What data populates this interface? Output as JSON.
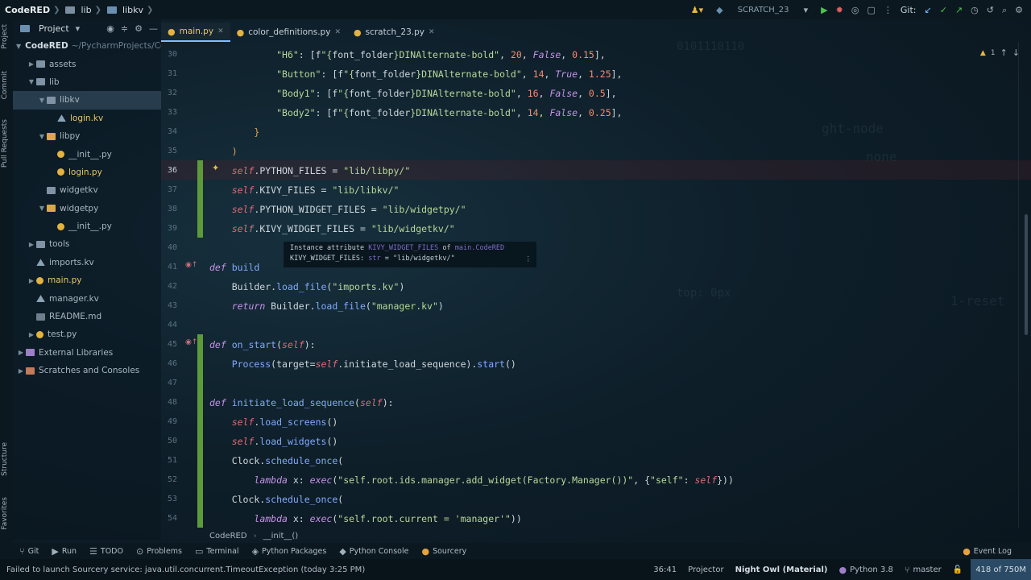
{
  "titlebar": {
    "crumbs": [
      "CodeRED",
      "lib",
      "libkv"
    ],
    "run_config": "SCRATCH_23",
    "git_label": "Git:"
  },
  "left_strip": {
    "top_labels": [
      "Project",
      "Commit",
      "Pull Requests"
    ],
    "bottom_labels": [
      "Structure",
      "Favorites"
    ]
  },
  "project": {
    "header": "Project",
    "tree": [
      {
        "name": "CodeRED",
        "path": "~/PycharmProjects/Co",
        "indent": 0,
        "type": "folder-b",
        "arrow": "▼"
      },
      {
        "name": "assets",
        "indent": 1,
        "type": "folder",
        "arrow": "▶"
      },
      {
        "name": "lib",
        "indent": 1,
        "type": "folder",
        "arrow": "▼"
      },
      {
        "name": "libkv",
        "indent": 2,
        "type": "folder",
        "arrow": "▼",
        "selected": true
      },
      {
        "name": "login.kv",
        "indent": 3,
        "type": "kv",
        "yellow": true
      },
      {
        "name": "libpy",
        "indent": 2,
        "type": "folder-y",
        "arrow": "▼"
      },
      {
        "name": "__init__.py",
        "indent": 3,
        "type": "py"
      },
      {
        "name": "login.py",
        "indent": 3,
        "type": "py",
        "yellow": true
      },
      {
        "name": "widgetkv",
        "indent": 2,
        "type": "folder"
      },
      {
        "name": "widgetpy",
        "indent": 2,
        "type": "folder-y",
        "arrow": "▼"
      },
      {
        "name": "__init__.py",
        "indent": 3,
        "type": "py"
      },
      {
        "name": "tools",
        "indent": 1,
        "type": "folder",
        "arrow": "▶"
      },
      {
        "name": "imports.kv",
        "indent": 1,
        "type": "kv"
      },
      {
        "name": "main.py",
        "indent": 1,
        "type": "py",
        "yellow": true,
        "arrow": "▶"
      },
      {
        "name": "manager.kv",
        "indent": 1,
        "type": "kv"
      },
      {
        "name": "README.md",
        "indent": 1,
        "type": "md"
      },
      {
        "name": "test.py",
        "indent": 1,
        "type": "py",
        "arrow": "▶"
      },
      {
        "name": "External Libraries",
        "indent": 0,
        "type": "lib",
        "arrow": "▶"
      },
      {
        "name": "Scratches and Consoles",
        "indent": 0,
        "type": "scr",
        "arrow": "▶"
      }
    ]
  },
  "tabs": [
    {
      "label": "main.py",
      "active": true
    },
    {
      "label": "color_definitions.py",
      "active": false
    },
    {
      "label": "scratch_23.py",
      "active": false
    }
  ],
  "inspection": {
    "warning_count": "1"
  },
  "gutter": {
    "lines": [
      "30",
      "31",
      "32",
      "33",
      "34",
      "35",
      "36",
      "37",
      "38",
      "39",
      "40",
      "41",
      "42",
      "43",
      "44",
      "45",
      "46",
      "47",
      "48",
      "49",
      "50",
      "51",
      "52",
      "53",
      "54"
    ],
    "current_line": "36"
  },
  "code": [
    "<i></i>            <span class='s'>\"H6\"</span>: [f<span class='s'>\"{</span>font_folder<span class='s'>}DINAlternate-bold\"</span>, <span class='num'>20</span>, <span class='bool'>False</span>, <span class='num'>0.15</span>],",
    "            <span class='s'>\"Button\"</span>: [f<span class='s'>\"{</span>font_folder<span class='s'>}DINAlternate-bold\"</span>, <span class='num'>14</span>, <span class='bool'>True</span>, <span class='num'>1.25</span>],",
    "            <span class='s'>\"Body1\"</span>: [f<span class='s'>\"{</span>font_folder<span class='s'>}DINAlternate-bold\"</span>, <span class='num'>16</span>, <span class='bool'>False</span>, <span class='num'>0.5</span>],",
    "            <span class='s'>\"Body2\"</span>: [f<span class='s'>\"{</span>font_folder<span class='s'>}DINAlternate-bold\"</span>, <span class='num'>14</span>, <span class='bool'>False</span>, <span class='num'>0.25</span>],",
    "        <span class='br'>}</span>",
    "    <span class='br'>)</span>",
    "    <span class='sf'>self</span>.PYTHON_FILES = <span class='s'>\"lib/libpy/\"</span>",
    "    <span class='sf'>self</span>.KIVY_FILES = <span class='s'>\"lib/libkv/\"</span>",
    "    <span class='sf'>self</span>.PYTHON_WIDGET_FILES = <span class='s'>\"lib/widgetpy/\"</span>",
    "    <span class='sf'>self</span>.KIVY_WIDGET_FILES = <span class='s'>\"lib/widgetkv/\"</span>",
    "",
    "<span class='def'>def</span> <span class='fn'>build</span>",
    "    Builder.<span class='fn'>load_file</span>(<span class='s'>\"imports.kv\"</span>)",
    "    <span class='kw'>return</span> Builder.<span class='fn'>load_file</span>(<span class='s'>\"manager.kv\"</span>)",
    "",
    "<span class='def'>def</span> <span class='fn'>on_start</span>(<span class='sf'>self</span>):",
    "    <span class='fn'>Process</span>(target=<span class='sf'>self</span>.initiate_load_sequence).<span class='fn'>start</span>()",
    "",
    "<span class='def'>def</span> <span class='fn'>initiate_load_sequence</span>(<span class='sf'>self</span>):",
    "    <span class='sf'>self</span>.<span class='fn'>load_screens</span>()",
    "    <span class='sf'>self</span>.<span class='fn'>load_widgets</span>()",
    "    Clock.<span class='fn'>schedule_once</span>(",
    "        <span class='kw'>lambda</span> x: <span class='kw'>exec</span>(<span class='s'>\"self.root.ids.manager.add_widget(Factory.Manager())\"</span>, {<span class='s'>\"self\"</span>: <span class='sf'>self</span>}))",
    "    Clock.<span class='fn'>schedule_once</span>(",
    "        <span class='kw'>lambda</span> x: <span class='kw'>exec</span>(<span class='s'>\"self.root.current = 'manager'\"</span>))"
  ],
  "code_plain": [
    "            \"H6\": [f\"{font_folder}DINAlternate-bold\", 20, False, 0.15],",
    "            \"Button\": [f\"{font_folder}DINAlternate-bold\", 14, True, 1.25],",
    "            \"Body1\": [f\"{font_folder}DINAlternate-bold\", 16, False, 0.5],",
    "            \"Body2\": [f\"{font_folder}DINAlternate-bold\", 14, False, 0.25],",
    "        }",
    "    )",
    "    self.PYTHON_FILES = \"lib/libpy/\"",
    "    self.KIVY_FILES = \"lib/libkv/\"",
    "    self.PYTHON_WIDGET_FILES = \"lib/widgetpy/\"",
    "    self.KIVY_WIDGET_FILES = \"lib/widgetkv/\"",
    "",
    "def build",
    "    Builder.load_file(\"imports.kv\")",
    "    return Builder.load_file(\"manager.kv\")",
    "",
    "def on_start(self):",
    "    Process(target=self.initiate_load_sequence).start()",
    "",
    "def initiate_load_sequence(self):",
    "    self.load_screens()",
    "    self.load_widgets()",
    "    Clock.schedule_once(",
    "        lambda x: exec(\"self.root.ids.manager.add_widget(Factory.Manager())\", {\"self\": self}))",
    "    Clock.schedule_once(",
    "        lambda x: exec(\"self.root.current = 'manager'\"))"
  ],
  "tooltip": {
    "line1_prefix": "Instance attribute",
    "line1_attr": "KIVY_WIDGET_FILES",
    "line1_of": "of",
    "line1_class": "main.CodeRED",
    "line2_name": "KIVY_WIDGET_FILES:",
    "line2_type": "str",
    "line2_value": "= \"lib/widgetkv/\""
  },
  "breadcrumb": [
    "CodeRED",
    "__init__()"
  ],
  "toolwindows": [
    {
      "label": "Git",
      "icon": "⑂"
    },
    {
      "label": "Run",
      "icon": "▶"
    },
    {
      "label": "TODO",
      "icon": "☰"
    },
    {
      "label": "Problems",
      "icon": "⊙"
    },
    {
      "label": "Terminal",
      "icon": "▭"
    },
    {
      "label": "Python Packages",
      "icon": "◈"
    },
    {
      "label": "Python Console",
      "icon": "◆"
    },
    {
      "label": "Sourcery",
      "icon": "●"
    }
  ],
  "event_log": "Event Log",
  "status": {
    "message": "Failed to launch Sourcery service: java.util.concurrent.TimeoutException (today 3:25 PM)",
    "position": "36:41",
    "projector": "Projector",
    "theme": "Night Owl (Material)",
    "interpreter": "Python 3.8",
    "branch": "master",
    "memory": "418 of 750M"
  },
  "background_text": [
    "ght-node",
    "none",
    "top: 0px",
    "1-reset",
    "0101110110"
  ]
}
